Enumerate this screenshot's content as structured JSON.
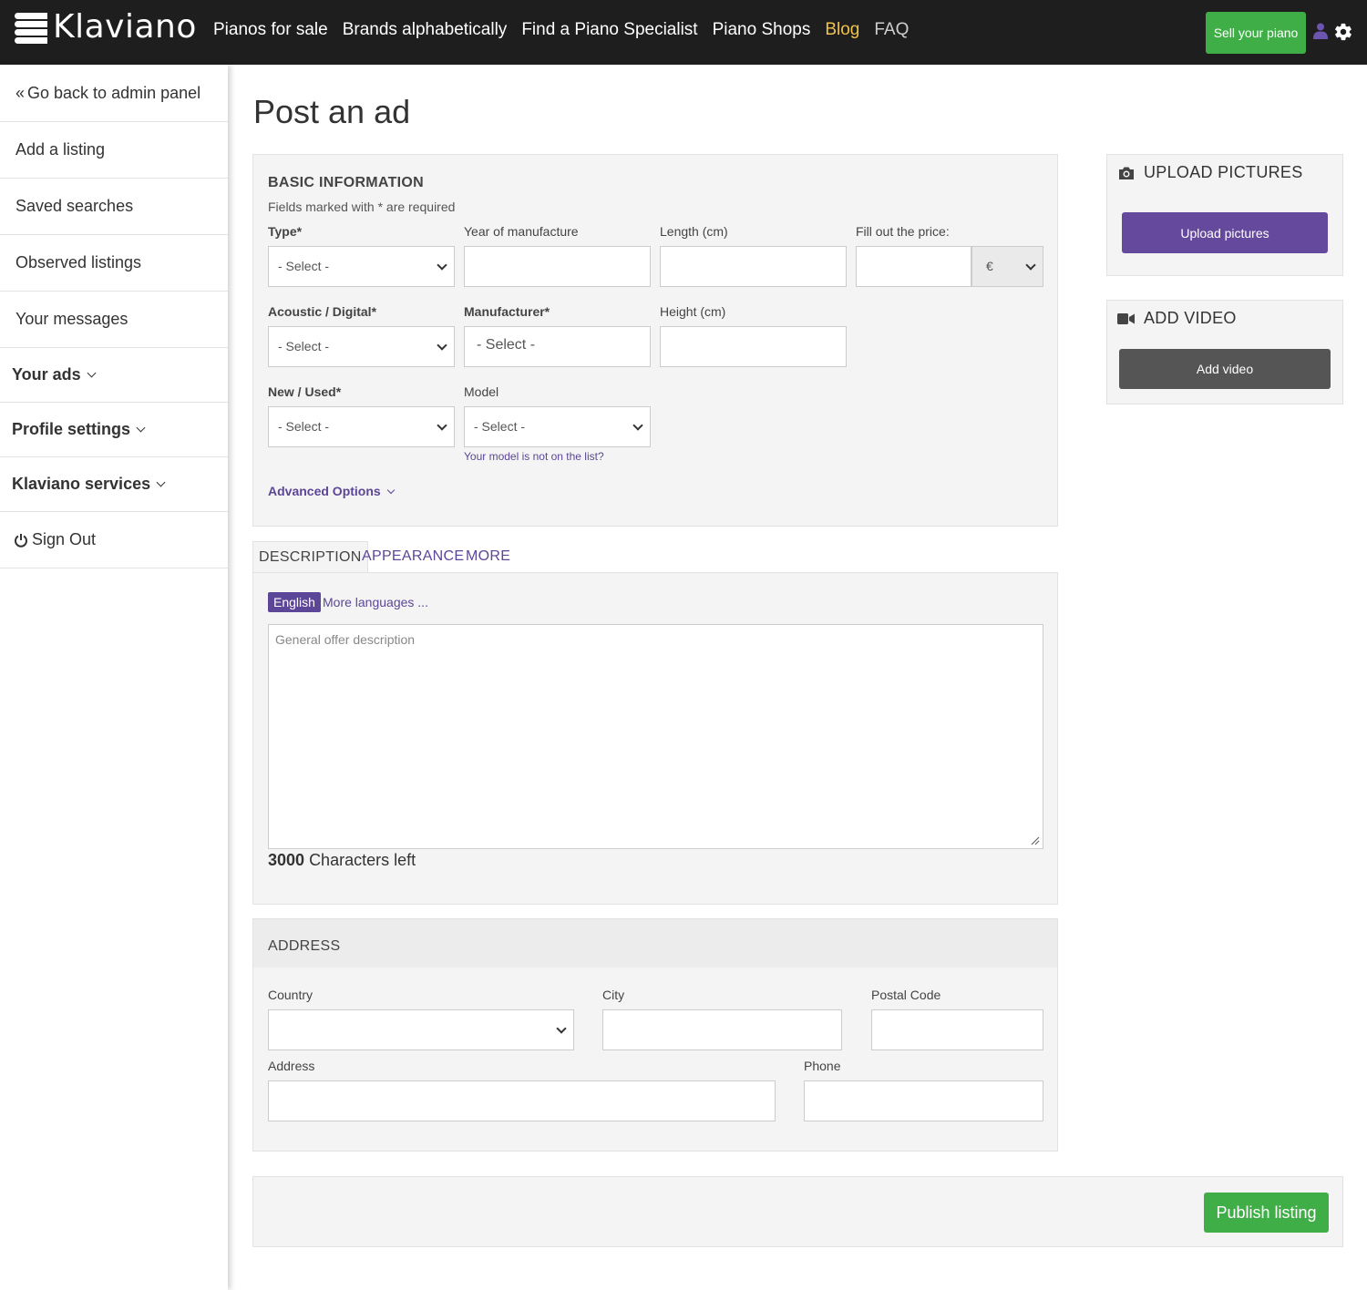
{
  "brand": {
    "name": "Klaviano"
  },
  "nav": {
    "items": [
      "Pianos for sale",
      "Brands alphabetically",
      "Find a Piano Specialist",
      "Piano Shops",
      "Blog",
      "FAQ"
    ],
    "sell_button": "Sell your piano"
  },
  "sidebar": {
    "back": "Go back to admin panel",
    "items": [
      "Add a listing",
      "Saved searches",
      "Observed listings",
      "Your messages"
    ],
    "groups": [
      "Your ads",
      "Profile settings",
      "Klaviano services"
    ],
    "sign_out": "Sign Out"
  },
  "page": {
    "title": "Post an ad"
  },
  "basic": {
    "title": "BASIC INFORMATION",
    "required_note": "Fields marked with * are required",
    "type_label": "Type*",
    "type_value": "- Select -",
    "year_label": "Year of manufacture",
    "length_label": "Length (cm)",
    "price_label": "Fill out the price:",
    "currency": "€",
    "acoustic_label": "Acoustic / Digital*",
    "acoustic_value": "- Select -",
    "manufacturer_label": "Manufacturer*",
    "manufacturer_value": "- Select -",
    "height_label": "Height (cm)",
    "new_used_label": "New / Used*",
    "new_used_value": "- Select -",
    "model_label": "Model",
    "model_value": "- Select -",
    "model_missing_link": "Your model is not on the list?",
    "advanced": "Advanced Options"
  },
  "tabs": [
    "DESCRIPTION",
    "APPEARANCE",
    "MORE"
  ],
  "description": {
    "language": "English",
    "more_languages": "More languages ...",
    "placeholder": "General offer description",
    "chars_count": "3000",
    "chars_text": "Characters left"
  },
  "address": {
    "title": "ADDRESS",
    "country_label": "Country",
    "city_label": "City",
    "postal_label": "Postal Code",
    "address_label": "Address",
    "phone_label": "Phone"
  },
  "upload": {
    "title": "UPLOAD PICTURES",
    "button": "Upload pictures"
  },
  "video": {
    "title": "ADD VIDEO",
    "button": "Add video"
  },
  "publish": "Publish listing",
  "colors": {
    "accent": "#65499d",
    "green": "#3fae47",
    "nav_bg": "#1e1e1e",
    "blog": "#f0c24b"
  }
}
